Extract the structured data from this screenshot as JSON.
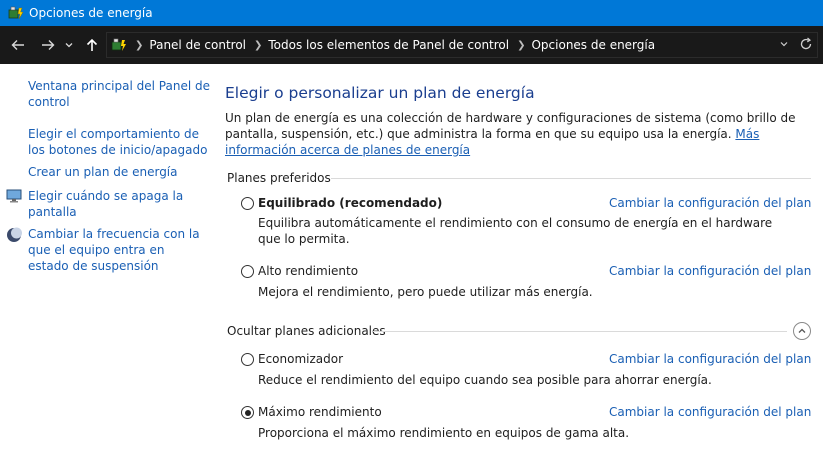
{
  "window": {
    "title": "Opciones de energía"
  },
  "address": {
    "breadcrumbs": [
      "Panel de control",
      "Todos los elementos de Panel de control",
      "Opciones de energía"
    ]
  },
  "leftpane": {
    "links": [
      "Ventana principal del Panel de control",
      "Elegir el comportamiento de los botones de inicio/apagado",
      "Crear un plan de energía",
      "Elegir cuándo se apaga la pantalla",
      "Cambiar la frecuencia con la que el equipo entra en estado de suspensión"
    ]
  },
  "main": {
    "title": "Elegir o personalizar un plan de energía",
    "description": "Un plan de energía es una colección de hardware y configuraciones de sistema (como brillo de pantalla, suspensión, etc.) que administra la forma en que su equipo usa la energía.",
    "more_info_link": "Más información acerca de planes de energía",
    "preferred_header": "Planes preferidos",
    "additional_header": "Ocultar planes adicionales",
    "change_link": "Cambiar la configuración del plan",
    "plans": [
      {
        "name": "Equilibrado (recomendado)",
        "description": "Equilibra automáticamente el rendimiento con el consumo de energía en el hardware que lo permita.",
        "selected": false
      },
      {
        "name": "Alto rendimiento",
        "description": "Mejora el rendimiento, pero puede utilizar más energía.",
        "selected": false
      },
      {
        "name": "Economizador",
        "description": "Reduce el rendimiento del equipo cuando sea posible para ahorrar energía.",
        "selected": false
      },
      {
        "name": "Máximo rendimiento",
        "description": "Proporciona el máximo rendimiento en equipos de gama alta.",
        "selected": true
      }
    ]
  },
  "colors": {
    "titlebar": "#0078d7",
    "link": "#1a5fb4",
    "heading": "#1a3e8f",
    "addressbar": "#191919"
  },
  "icons": {
    "app": "power-options-icon",
    "back": "arrow-left-icon",
    "forward": "arrow-right-icon",
    "recent": "chevron-down-icon",
    "up": "arrow-up-icon",
    "refresh": "refresh-icon",
    "display": "monitor-icon",
    "sleep": "moon-icon",
    "collapse": "chevron-up-icon"
  }
}
